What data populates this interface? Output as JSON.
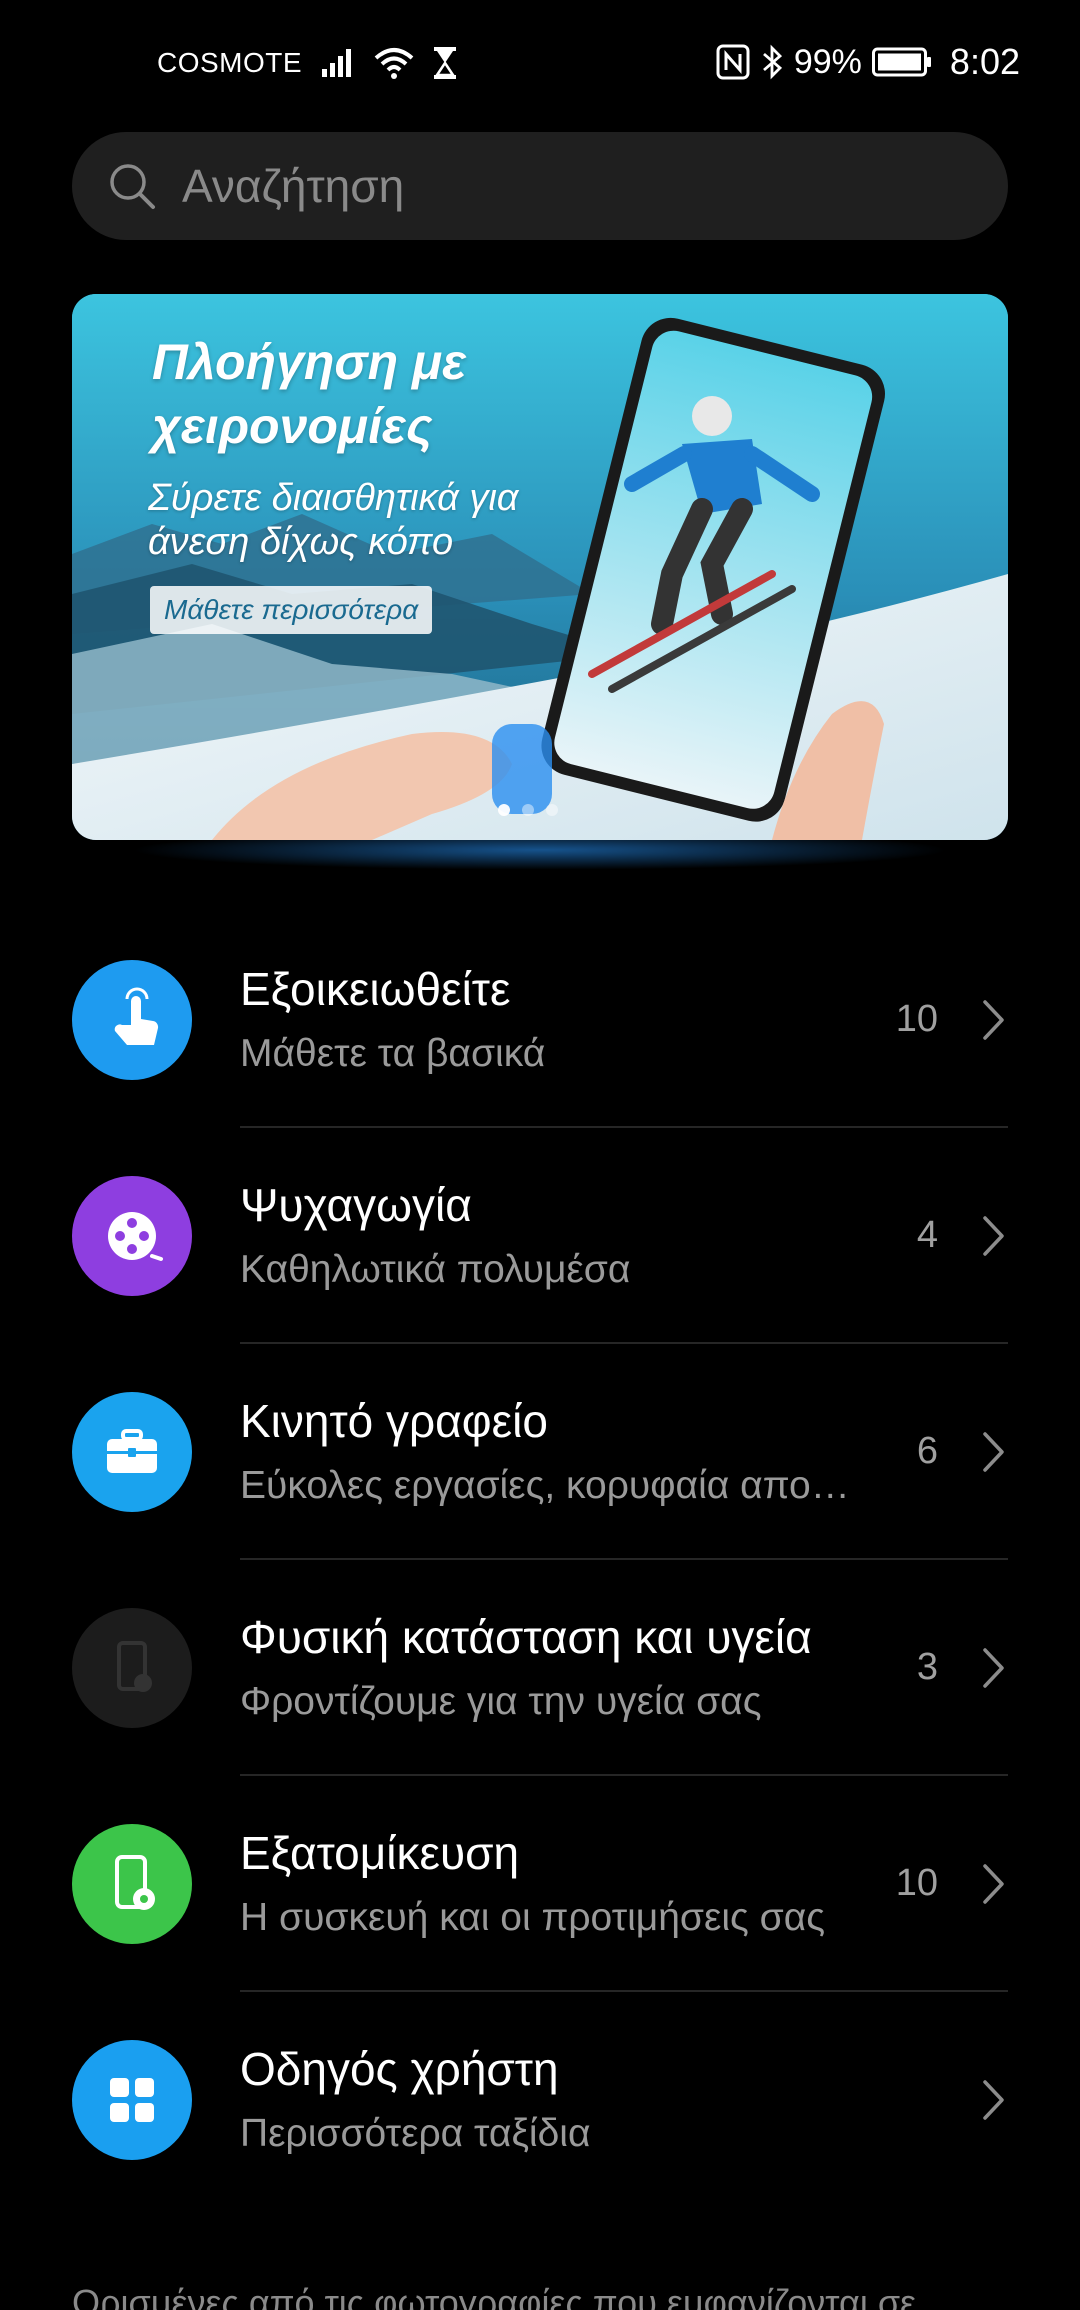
{
  "status_bar": {
    "carrier": "COSMOTE",
    "battery": "99%",
    "time": "8:02",
    "icons": [
      "signal-icon",
      "wifi-icon",
      "hourglass-icon",
      "nfc-icon",
      "bluetooth-icon",
      "battery-icon"
    ]
  },
  "search": {
    "placeholder": "Αναζήτηση"
  },
  "banner": {
    "title": "Πλοήγηση με χειρονομίες",
    "subtitle": "Σύρετε διαισθητικά για άνεση δίχως κόπο",
    "cta": "Μάθετε περισσότερα",
    "pages": 3,
    "active_page": 1
  },
  "items": [
    {
      "title": "Εξοικειωθείτε",
      "subtitle": "Μάθετε τα βασικά",
      "count": "10",
      "icon": "touch-hand-icon",
      "color": "#1e9bf0"
    },
    {
      "title": "Ψυχαγωγία",
      "subtitle": "Καθηλωτικά πολυμέσα",
      "count": "4",
      "icon": "film-reel-icon",
      "color": "#8e3ee0"
    },
    {
      "title": "Κινητό γραφείο",
      "subtitle": "Εύκολες εργασίες, κορυφαία αποδοτικότητα",
      "count": "6",
      "icon": "briefcase-icon",
      "color": "#1aa3ee"
    },
    {
      "title": "Φυσική κατάσταση και υγεία",
      "subtitle": "Φροντίζουμε για την υγεία σας",
      "count": "3",
      "icon": "phone-settings-icon",
      "color": "#1c1c1c"
    },
    {
      "title": "Εξατομίκευση",
      "subtitle": "Η συσκευή και οι προτιμήσεις σας",
      "count": "10",
      "icon": "phone-gear-icon",
      "color": "#3cc54a"
    },
    {
      "title": "Οδηγός χρήστη",
      "subtitle": "Περισσότερα ταξίδια",
      "count": "",
      "icon": "grid-icon",
      "color": "#1a9ff0"
    }
  ],
  "footer": {
    "note": "Ορισμένες από τις φωτογραφίες που εμφανίζονται σε"
  }
}
